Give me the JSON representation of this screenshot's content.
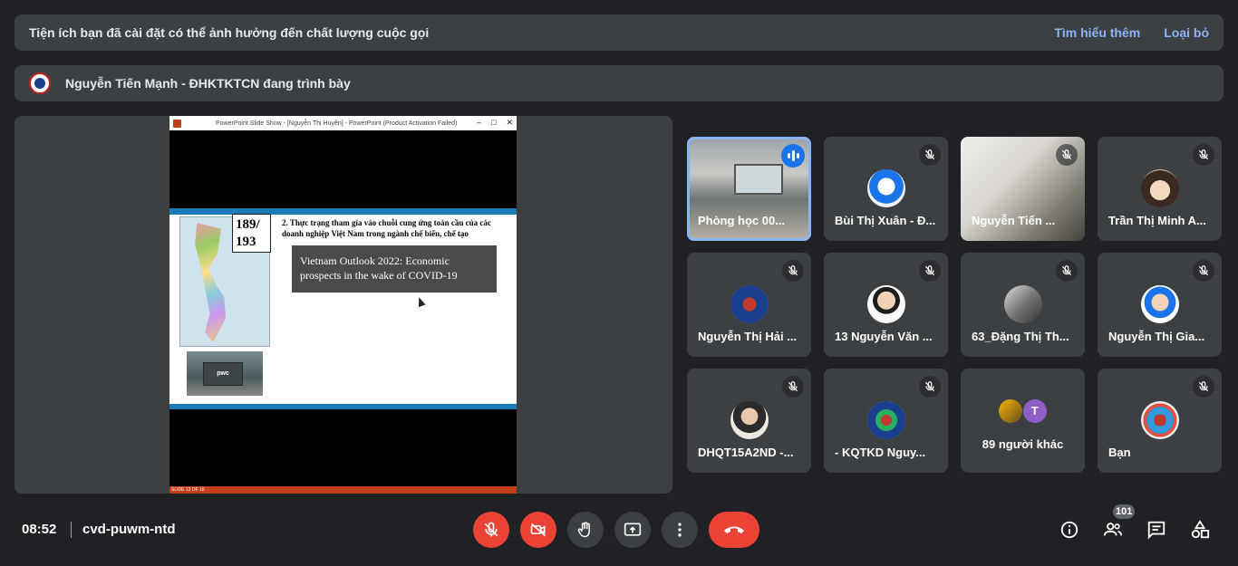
{
  "notice": {
    "message": "Tiện ích bạn đã cài đặt có thể ảnh hưởng đến chất lượng cuộc gọi",
    "learn_more": "Tìm hiểu thêm",
    "dismiss": "Loại bỏ"
  },
  "presenting": {
    "text": "Nguyễn Tiến Mạnh - ĐHKTKTCN đang trình bày"
  },
  "slideshow": {
    "window_title": "PowerPoint Slide Show - [Nguyễn Thị Huyền] - PowerPoint (Product Activation Failed)",
    "slide_number": "189/ 193",
    "heading": "2. Thực trạng tham gia vào chuỗi cung ứng toàn cầu của các doanh nghiệp Việt Nam trong ngành chế biến, chế tạo",
    "book_title": "Vietnam Outlook 2022: Economic prospects in the wake of COVID-19",
    "sign_text": "pwc",
    "status": "SLIDE 12 OF 16"
  },
  "participants": [
    {
      "name": "Phòng học 00...",
      "state": "speaking"
    },
    {
      "name": "Bùi Thị Xuân - Đ...",
      "state": "muted"
    },
    {
      "name": "Nguyễn Tiến ...",
      "state": "muted"
    },
    {
      "name": "Trần Thị Minh A...",
      "state": "muted"
    },
    {
      "name": "Nguyễn Thị Hải ...",
      "state": "muted"
    },
    {
      "name": "13 Nguyễn Văn ...",
      "state": "muted"
    },
    {
      "name": "63_Đặng Thị Th...",
      "state": "muted"
    },
    {
      "name": "Nguyễn Thị Gia...",
      "state": "muted"
    },
    {
      "name": "DHQT15A2ND -...",
      "state": "muted"
    },
    {
      "name": "- KQTKD Nguy...",
      "state": "muted"
    },
    {
      "name": "89 người khác",
      "state": "others",
      "initial": "T"
    },
    {
      "name": "Bạn",
      "state": "muted"
    }
  ],
  "footer": {
    "time": "08:52",
    "meeting_code": "cvd-puwm-ntd",
    "participant_count": "101"
  },
  "colors": {
    "accent": "#8ab4f8",
    "danger": "#ea4335",
    "surface": "#3c4043",
    "background": "#202124"
  }
}
